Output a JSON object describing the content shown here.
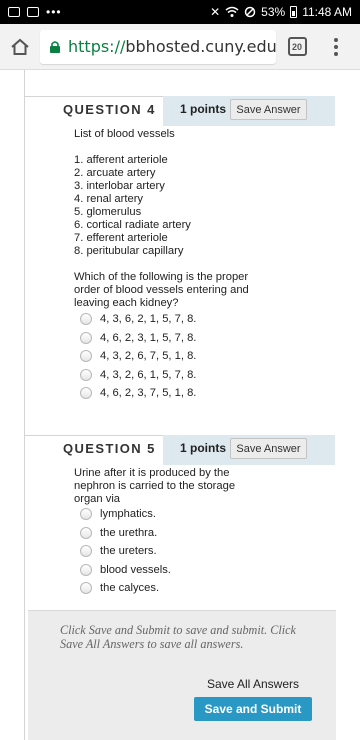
{
  "status_bar": {
    "battery": "53%",
    "time": "11:48 AM"
  },
  "browser": {
    "url_scheme": "https://",
    "url_rest": "bbhosted.cuny.edu/w",
    "tab_count": "20"
  },
  "questions": [
    {
      "title": "QUESTION 4",
      "points": "1 points",
      "save_label": "Save Answer",
      "intro": "List of blood vessels",
      "list": [
        "1. afferent arteriole",
        "2. arcuate artery",
        "3. interlobar artery",
        "4. renal artery",
        "5. glomerulus",
        "6. cortical radiate artery",
        "7. efferent arteriole",
        "8. peritubular capillary"
      ],
      "prompt_lines": [
        "Which of the following is the proper",
        "order of blood vessels entering and",
        "leaving each kidney?"
      ],
      "options": [
        "4, 3, 6, 2, 1, 5, 7, 8.",
        "4, 6, 2, 3, 1, 5, 7, 8.",
        "4, 3, 2, 6, 7, 5, 1, 8.",
        "4, 3, 2, 6, 1, 5, 7, 8.",
        "4, 6, 2, 3, 7, 5, 1, 8."
      ]
    },
    {
      "title": "QUESTION 5",
      "points": "1 points",
      "save_label": "Save Answer",
      "prompt_lines": [
        "Urine after it is produced by the",
        "nephron is carried to the storage",
        "organ via"
      ],
      "options": [
        "lymphatics.",
        "the urethra.",
        "the ureters.",
        "blood vessels.",
        "the calyces."
      ]
    }
  ],
  "submit": {
    "note_line1": "Click Save and Submit to save and submit. Click",
    "note_line2": "Save All Answers to save all answers.",
    "save_all_label": "Save All Answers",
    "save_submit_label": "Save and Submit"
  },
  "colors": {
    "header_bg": "#dde9ef",
    "submit_button": "#2a98c4",
    "url_scheme": "#0b8043"
  }
}
